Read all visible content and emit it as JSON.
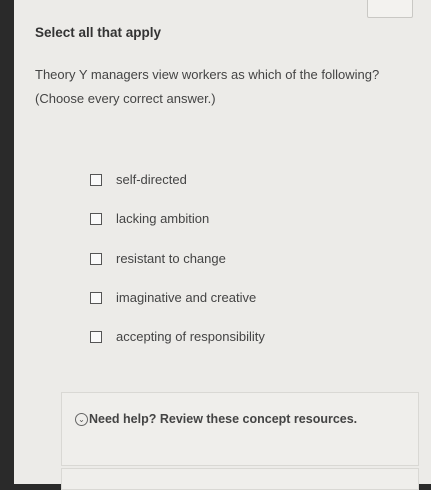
{
  "question": {
    "heading": "Select all that apply",
    "text": "Theory Y managers view workers as which of the following? (Choose every correct answer.)"
  },
  "options": [
    {
      "label": "self-directed",
      "checked": false
    },
    {
      "label": "lacking ambition",
      "checked": false
    },
    {
      "label": "resistant to change",
      "checked": false
    },
    {
      "label": "imaginative and creative",
      "checked": false
    },
    {
      "label": "accepting of responsibility",
      "checked": false
    }
  ],
  "help": {
    "text": "Need help? Review these concept resources.",
    "icon": "chevron-down-circle-icon"
  }
}
